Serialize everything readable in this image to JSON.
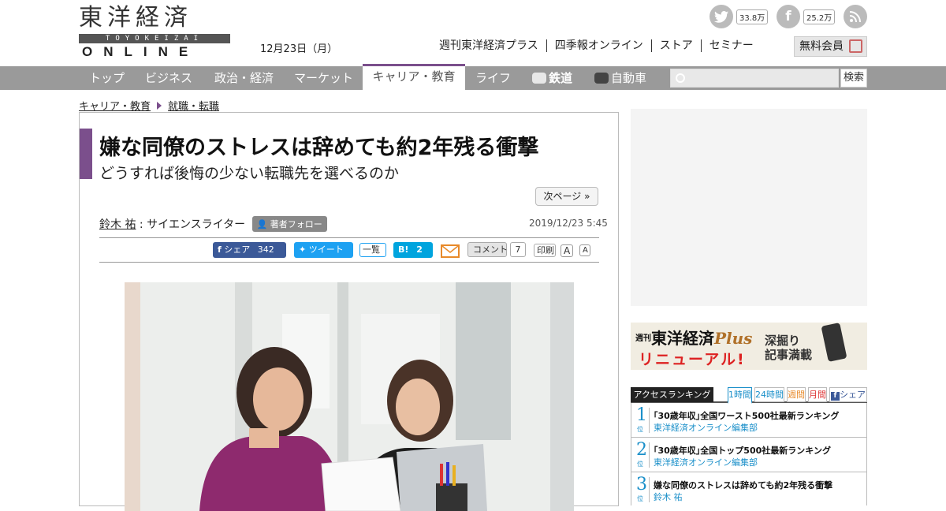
{
  "header": {
    "logo_kanji": "東洋経済",
    "logo_romaji": "TOYOKEIZAI",
    "logo_online": "ONLINE",
    "date": "12月23日（月）",
    "social": [
      {
        "icon": "twitter-icon",
        "count": "33.8万"
      },
      {
        "icon": "facebook-icon",
        "count": "25.2万"
      },
      {
        "icon": "rss-icon"
      }
    ],
    "links": [
      "週刊東洋経済プラス",
      "四季報オンライン",
      "ストア",
      "セミナー"
    ],
    "free_member": "無料会員"
  },
  "nav": {
    "items": [
      "トップ",
      "ビジネス",
      "政治・経済",
      "マーケット",
      "キャリア・教育",
      "ライフ",
      "鉄道",
      "自動車"
    ],
    "active_index": 4,
    "search_button": "検索"
  },
  "breadcrumb": [
    "キャリア・教育",
    "就職・転職"
  ],
  "article": {
    "title": "嫌な同僚のストレスは辞めても約2年残る衝撃",
    "subtitle": "どうすれば後悔の少ない転職先を選べるのか",
    "next_page": "次ページ »",
    "author_name": "鈴木 祐",
    "author_role": "サイエンスライター",
    "follow": "著者フォロー",
    "pubdate": "2019/12/23 5:45",
    "share": {
      "facebook": "シェア",
      "facebook_count": "342",
      "tweet": "ツイート",
      "list": "一覧",
      "hatena": "B!",
      "hatena_count": "2",
      "comment": "コメント",
      "comment_count": "7",
      "print": "印刷",
      "font_large": "A",
      "font_small": "A"
    }
  },
  "sidebar": {
    "banner": {
      "line1_a": "東洋経済",
      "line1_b": "Plus",
      "line2": "リニューアル!",
      "line3_a": "深掘り",
      "line3_b": "記事満載",
      "mark": "週刊"
    },
    "ranking": {
      "title": "アクセスランキング",
      "tabs": [
        "1時間",
        "24時間",
        "週間",
        "月間",
        "シェア"
      ],
      "items": [
        {
          "rank": "1",
          "suffix": "位",
          "headline": "｢30歳年収｣全国ワースト500社最新ランキング",
          "source": "東洋経済オンライン編集部"
        },
        {
          "rank": "2",
          "suffix": "位",
          "headline": "｢30歳年収｣全国トップ500社最新ランキング",
          "source": "東洋経済オンライン編集部"
        },
        {
          "rank": "3",
          "suffix": "位",
          "headline": "嫌な同僚のストレスは辞めても約2年残る衝撃",
          "source": "鈴木 祐"
        }
      ]
    }
  },
  "colors": {
    "accent_purple": "#7b4f8c",
    "nav_gray": "#9a9a9a",
    "facebook_blue": "#3b5998",
    "twitter_blue": "#1da1f2",
    "hatena_blue": "#00a4de",
    "rank_blue": "#1a8fc9"
  }
}
